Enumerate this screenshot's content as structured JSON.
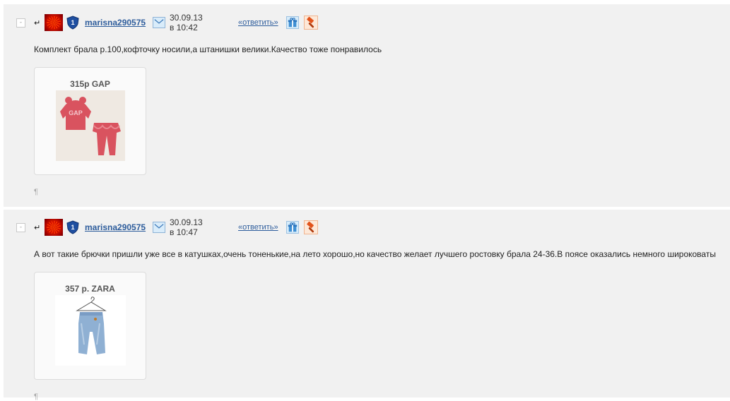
{
  "posts": [
    {
      "collapse_label": "-",
      "reply_arrow": "↵",
      "author": "marisna290575",
      "level_badge": "1",
      "date": "30.09.13 в 10:42",
      "reply_label": "«ответить»",
      "text": "Комплект брала р.100,кофточку носили,а штанишки велики.Качество тоже понравилось",
      "card_title": "315р GAP",
      "pilcrow": "¶"
    },
    {
      "collapse_label": "-",
      "reply_arrow": "↵",
      "author": "marisna290575",
      "level_badge": "1",
      "date": "30.09.13 в 10:47",
      "reply_label": "«ответить»",
      "text": "А вот такие брючки пришли уже все в катушках,очень тоненькие,на лето хорошо,но качество желает лучшего ростовку брала 24-36.В поясе оказались немного широковаты",
      "card_title": "357 р. ZARA",
      "pilcrow": "¶"
    }
  ],
  "icons": {
    "collapse": "collapse-icon",
    "reply_arrow": "reply-arrow-icon",
    "avatar": "avatar-flower-icon",
    "shield": "level-shield-icon",
    "mail": "mail-icon",
    "gift": "gift-icon",
    "hammer": "hammer-icon"
  },
  "colors": {
    "link": "#2e5d9c",
    "post_bg": "#f1f1f1",
    "shield": "#1f4fa0"
  }
}
